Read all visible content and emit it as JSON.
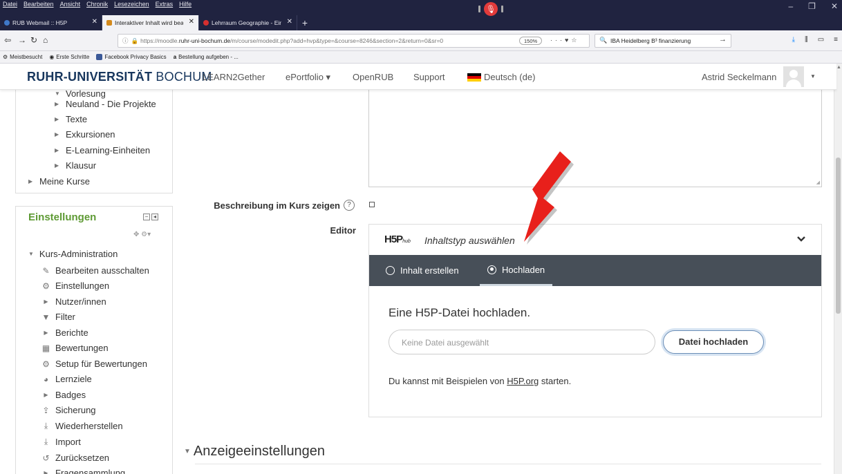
{
  "browser": {
    "menu": [
      "Datei",
      "Bearbeiten",
      "Ansicht",
      "Chronik",
      "Lesezeichen",
      "Extras",
      "Hilfe"
    ],
    "tabs": [
      {
        "title": "RUB Webmail :: H5P",
        "active": false,
        "favicon_color": "#3f78c8"
      },
      {
        "title": "Interaktiver Inhalt wird bearbeit",
        "active": true,
        "favicon_color": "#d48a1c"
      },
      {
        "title": "Lehrraum Geographie - Einsen",
        "active": false,
        "favicon_color": "#d62f2f"
      }
    ],
    "new_tab": "+",
    "url_scheme": "https://moodle.",
    "url_host": "ruhr-uni-bochum.de",
    "url_path": "/m/course/modedit.php?add=hvp&type=&course=8246&section=2&return=0&sr=0",
    "zoom": "150%",
    "search_value": "IBA Heidelberg B³ finanzierung",
    "bookmarks": [
      {
        "label": "Meistbesucht",
        "color": "#8a8a8a"
      },
      {
        "label": "Erste Schritte",
        "color": "#5a5a5a"
      },
      {
        "label": "Facebook Privacy Basics",
        "color": "#3b5998"
      },
      {
        "label": "Bestellung aufgeben - ...",
        "color": "#111111"
      }
    ]
  },
  "moodle": {
    "brand_bold": "RUHR-UNIVERSITÄT",
    "brand_light": "BOCHUM",
    "nav": [
      "LEARN2Gether",
      "ePortfolio ▾",
      "OpenRUB",
      "Support"
    ],
    "language": "Deutsch (de)",
    "user": "Astrid Seckelmann"
  },
  "nav_tree": {
    "items": [
      "Vorlesung",
      "Neuland - Die Projekte",
      "Texte",
      "Exkursionen",
      "E-Learning-Einheiten",
      "Klausur"
    ],
    "my_courses": "Meine Kurse"
  },
  "settings": {
    "title": "Einstellungen",
    "section": "Kurs-Administration",
    "items": [
      {
        "label": "Bearbeiten ausschalten",
        "icon": "pencil-icon"
      },
      {
        "label": "Einstellungen",
        "icon": "gear-icon"
      },
      {
        "label": "Nutzer/innen",
        "icon": "triangle-right-icon"
      },
      {
        "label": "Filter",
        "icon": "filter-icon"
      },
      {
        "label": "Berichte",
        "icon": "triangle-right-icon"
      },
      {
        "label": "Bewertungen",
        "icon": "table-icon"
      },
      {
        "label": "Setup für Bewertungen",
        "icon": "gear-icon"
      },
      {
        "label": "Lernziele",
        "icon": "pie-chart-icon"
      },
      {
        "label": "Badges",
        "icon": "triangle-right-icon"
      },
      {
        "label": "Sicherung",
        "icon": "upload-icon"
      },
      {
        "label": "Wiederherstellen",
        "icon": "download-icon"
      },
      {
        "label": "Import",
        "icon": "download-icon"
      },
      {
        "label": "Zurücksetzen",
        "icon": "reset-icon"
      },
      {
        "label": "Fragensammlung",
        "icon": "triangle-right-icon"
      }
    ]
  },
  "form": {
    "show_description_label": "Beschreibung im Kurs zeigen",
    "editor_label": "Editor"
  },
  "h5p": {
    "logo": "H5P",
    "logo_suffix": "hub",
    "title": "Inhaltstyp auswählen",
    "tab_create": "Inhalt erstellen",
    "tab_upload": "Hochladen",
    "upload_heading": "Eine H5P-Datei hochladen.",
    "file_placeholder": "Keine Datei ausgewählt",
    "upload_button": "Datei hochladen",
    "examples_prefix": "Du kannst mit Beispielen von ",
    "examples_link": "H5P.org",
    "examples_suffix": " starten."
  },
  "section": {
    "title": "Anzeigeeinstellungen"
  },
  "colors": {
    "accent_green": "#5e9a34",
    "h5p_tabbar": "#474f58",
    "annotation_arrow": "#e8201b"
  }
}
